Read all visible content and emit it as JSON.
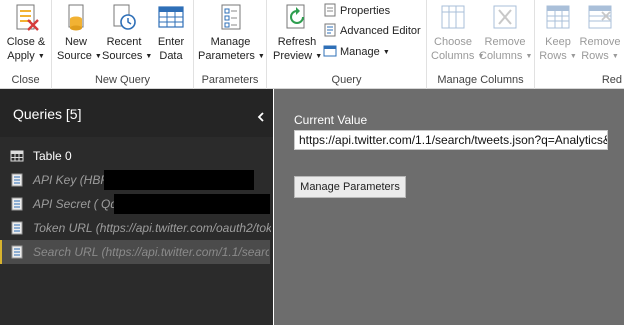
{
  "ribbon": {
    "groups": {
      "close": {
        "label": "Close",
        "close_apply": {
          "line1": "Close &",
          "line2": "Apply"
        }
      },
      "new_query": {
        "label": "New Query",
        "new_source": {
          "line1": "New",
          "line2": "Source"
        },
        "recent_sources": {
          "line1": "Recent",
          "line2": "Sources"
        },
        "enter_data": {
          "line1": "Enter",
          "line2": "Data"
        }
      },
      "parameters": {
        "label": "Parameters",
        "manage_parameters": {
          "line1": "Manage",
          "line2": "Parameters"
        }
      },
      "query": {
        "label": "Query",
        "refresh_preview": {
          "line1": "Refresh",
          "line2": "Preview"
        },
        "properties": "Properties",
        "advanced_editor": "Advanced Editor",
        "manage": "Manage"
      },
      "manage_columns": {
        "label": "Manage Columns",
        "choose_columns": {
          "line1": "Choose",
          "line2": "Columns"
        },
        "remove_columns": {
          "line1": "Remove",
          "line2": "Columns"
        }
      },
      "reduce_rows": {
        "label": "Red",
        "keep_rows": {
          "line1": "Keep",
          "line2": "Rows"
        },
        "remove_rows": {
          "line1": "Remove",
          "line2": "Rows"
        }
      }
    }
  },
  "queries_panel": {
    "title": "Queries [5]",
    "items": [
      {
        "label": "Table 0",
        "type": "table"
      },
      {
        "label": "API Key (HBF",
        "type": "parameter"
      },
      {
        "label": "API Secret ( QdB",
        "type": "parameter"
      },
      {
        "label": "Token URL (https://api.twitter.com/oauth2/tok",
        "type": "parameter"
      },
      {
        "label": "Search URL (https://api.twitter.com/1.1/search",
        "type": "parameter"
      }
    ]
  },
  "main": {
    "current_value_label": "Current Value",
    "current_value": "https://api.twitter.com/1.1/search/tweets.json?q=Analytics&",
    "manage_parameters_button": "Manage Parameters"
  },
  "colors": {
    "panel_bg": "#2b2b2b",
    "main_bg": "#6d6d6d",
    "selection_bar": "#d8b32e",
    "icon_blue": "#2e6fb7"
  }
}
